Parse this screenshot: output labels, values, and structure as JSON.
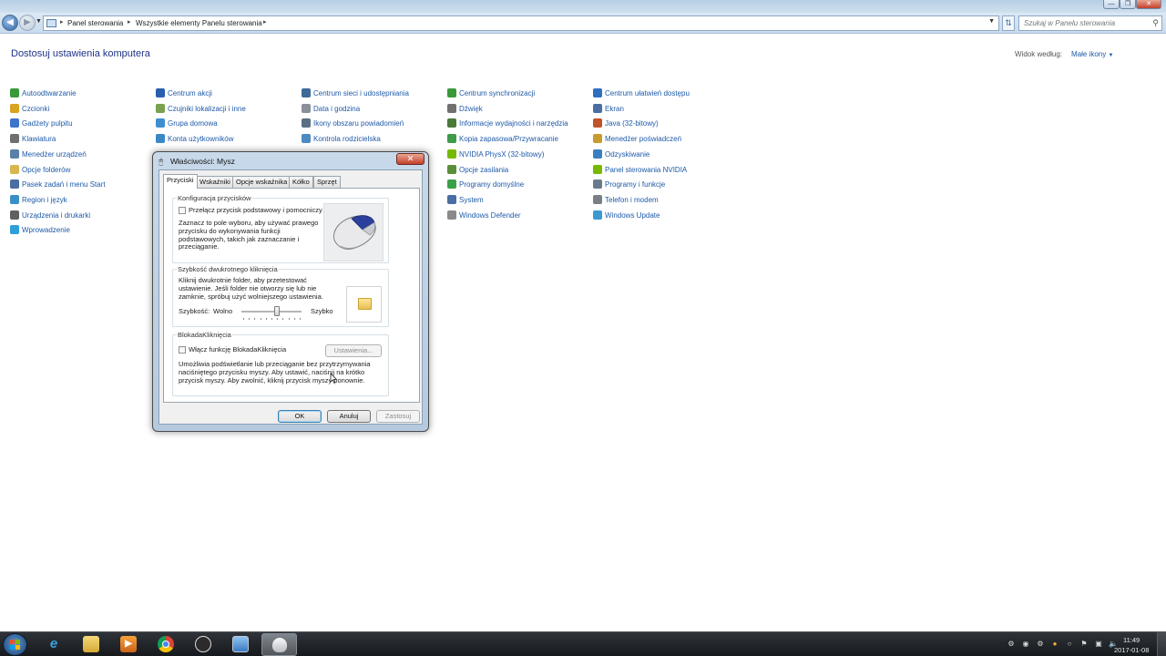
{
  "window": {
    "minimize": "—",
    "maximize": "❐",
    "close": "✕"
  },
  "address": {
    "crumbs": [
      "Panel sterowania",
      "Wszystkie elementy Panelu sterowania"
    ],
    "search_placeholder": "Szukaj w Panelu sterowania"
  },
  "content": {
    "heading": "Dostosuj ustawienia komputera",
    "view_by_label": "Widok według:",
    "view_by_value": "Małe ikony",
    "items": [
      {
        "label": "Autoodtwarzanie",
        "icon": "autoplay-icon",
        "color": "#3a9a3a"
      },
      {
        "label": "Czcionki",
        "icon": "fonts-icon",
        "color": "#d8a320"
      },
      {
        "label": "Gadżety pulpitu",
        "icon": "gadgets-icon",
        "color": "#3f74c8"
      },
      {
        "label": "Klawiatura",
        "icon": "keyboard-icon",
        "color": "#707070"
      },
      {
        "label": "Menedżer urządzeń",
        "icon": "device-manager-icon",
        "color": "#5a7fa8"
      },
      {
        "label": "Opcje folderów",
        "icon": "folder-options-icon",
        "color": "#d8b650"
      },
      {
        "label": "Pasek zadań i menu Start",
        "icon": "taskbar-icon",
        "color": "#4a6ea3"
      },
      {
        "label": "Region i język",
        "icon": "region-icon",
        "color": "#3a8fc8"
      },
      {
        "label": "Urządzenia i drukarki",
        "icon": "printer-icon",
        "color": "#606060"
      },
      {
        "label": "Wprowadzenie",
        "icon": "getting-started-icon",
        "color": "#2f9fd8"
      },
      {
        "label": "Centrum akcji",
        "icon": "action-center-flag-icon",
        "color": "#2a5fae"
      },
      {
        "label": "Czujniki lokalizacji i inne",
        "icon": "sensors-icon",
        "color": "#7aa050"
      },
      {
        "label": "Grupa domowa",
        "icon": "homegroup-icon",
        "color": "#3f8fd0"
      },
      {
        "label": "Konta użytkowników",
        "icon": "user-accounts-icon",
        "color": "#3a88c8"
      },
      {
        "label": "Centrum sieci i udostępniania",
        "icon": "network-icon",
        "color": "#3d6a99"
      },
      {
        "label": "Data i godzina",
        "icon": "date-time-icon",
        "color": "#8a8f99"
      },
      {
        "label": "Ikony obszaru powiadomień",
        "icon": "notification-icons-icon",
        "color": "#5b6f84"
      },
      {
        "label": "Kontrola rodzicielska",
        "icon": "parental-controls-icon",
        "color": "#4c8ac0"
      },
      {
        "label": "Centrum synchronizacji",
        "icon": "sync-center-icon",
        "color": "#3a9a3a"
      },
      {
        "label": "Dźwięk",
        "icon": "sound-icon",
        "color": "#707070"
      },
      {
        "label": "Informacje wydajności i narzędzia",
        "icon": "performance-icon",
        "color": "#4a7a3a"
      },
      {
        "label": "Kopia zapasowa/Przywracanie",
        "icon": "backup-icon",
        "color": "#3f9a4a"
      },
      {
        "label": "NVIDIA PhysX (32-bitowy)",
        "icon": "nvidia-physx-icon",
        "color": "#76b900"
      },
      {
        "label": "Opcje zasilania",
        "icon": "power-options-icon",
        "color": "#5a8f3a"
      },
      {
        "label": "Programy domyślne",
        "icon": "default-programs-icon",
        "color": "#3aa04a"
      },
      {
        "label": "System",
        "icon": "system-icon",
        "color": "#4a6ea3"
      },
      {
        "label": "Windows Defender",
        "icon": "defender-icon",
        "color": "#8a8a8a"
      },
      {
        "label": "Centrum ułatwień dostępu",
        "icon": "ease-of-access-icon",
        "color": "#2f6fc0"
      },
      {
        "label": "Ekran",
        "icon": "display-icon",
        "color": "#4a6ea3"
      },
      {
        "label": "Java (32-bitowy)",
        "icon": "java-icon",
        "color": "#c0532a"
      },
      {
        "label": "Menedżer poświadczeń",
        "icon": "credential-manager-icon",
        "color": "#c89a30"
      },
      {
        "label": "Odzyskiwanie",
        "icon": "recovery-icon",
        "color": "#3a7fc0"
      },
      {
        "label": "Panel sterowania NVIDIA",
        "icon": "nvidia-control-panel-icon",
        "color": "#76b900"
      },
      {
        "label": "Programy i funkcje",
        "icon": "programs-features-icon",
        "color": "#6a7a8a"
      },
      {
        "label": "Telefon i modem",
        "icon": "phone-modem-icon",
        "color": "#7a7f86"
      },
      {
        "label": "Windows Update",
        "icon": "windows-update-icon",
        "color": "#3a9ad0"
      }
    ]
  },
  "dialog": {
    "title": "Właściwości: Mysz",
    "tabs": [
      "Przyciski",
      "Wskaźniki",
      "Opcje wskaźnika",
      "Kółko",
      "Sprzęt"
    ],
    "button_config": {
      "group_label": "Konfiguracja przycisków",
      "checkbox_label": "Przełącz przycisk podstawowy i pomocniczy",
      "description": "Zaznacz to pole wyboru, aby używać prawego przycisku do wykonywania funkcji podstawowych, takich jak zaznaczanie i przeciąganie."
    },
    "double_click": {
      "group_label": "Szybkość dwukrotnego kliknięcia",
      "description": "Kliknij dwukrotnie folder, aby przetestować ustawienie. Jeśli folder nie otworzy się lub nie zamknie, spróbuj użyć wolniejszego ustawienia.",
      "speed_label": "Szybkość:",
      "slow_label": "Wolno",
      "fast_label": "Szybko",
      "speed_fraction": 0.6
    },
    "click_lock": {
      "group_label": "BlokadaKliknięcia",
      "checkbox_label": "Włącz funkcję BlokadaKliknięcia",
      "settings_button": "Ustawienia...",
      "description": "Umożliwia podświetlanie lub przeciąganie bez przytrzymywania naciśniętego przycisku myszy. Aby ustawić, naciśnij na krótko przycisk myszy. Aby zwolnić, kliknij przycisk myszy ponownie."
    },
    "buttons": {
      "ok": "OK",
      "cancel": "Anuluj",
      "apply": "Zastosuj"
    }
  },
  "taskbar": {
    "time": "11:49",
    "date": "2017-01-08"
  }
}
